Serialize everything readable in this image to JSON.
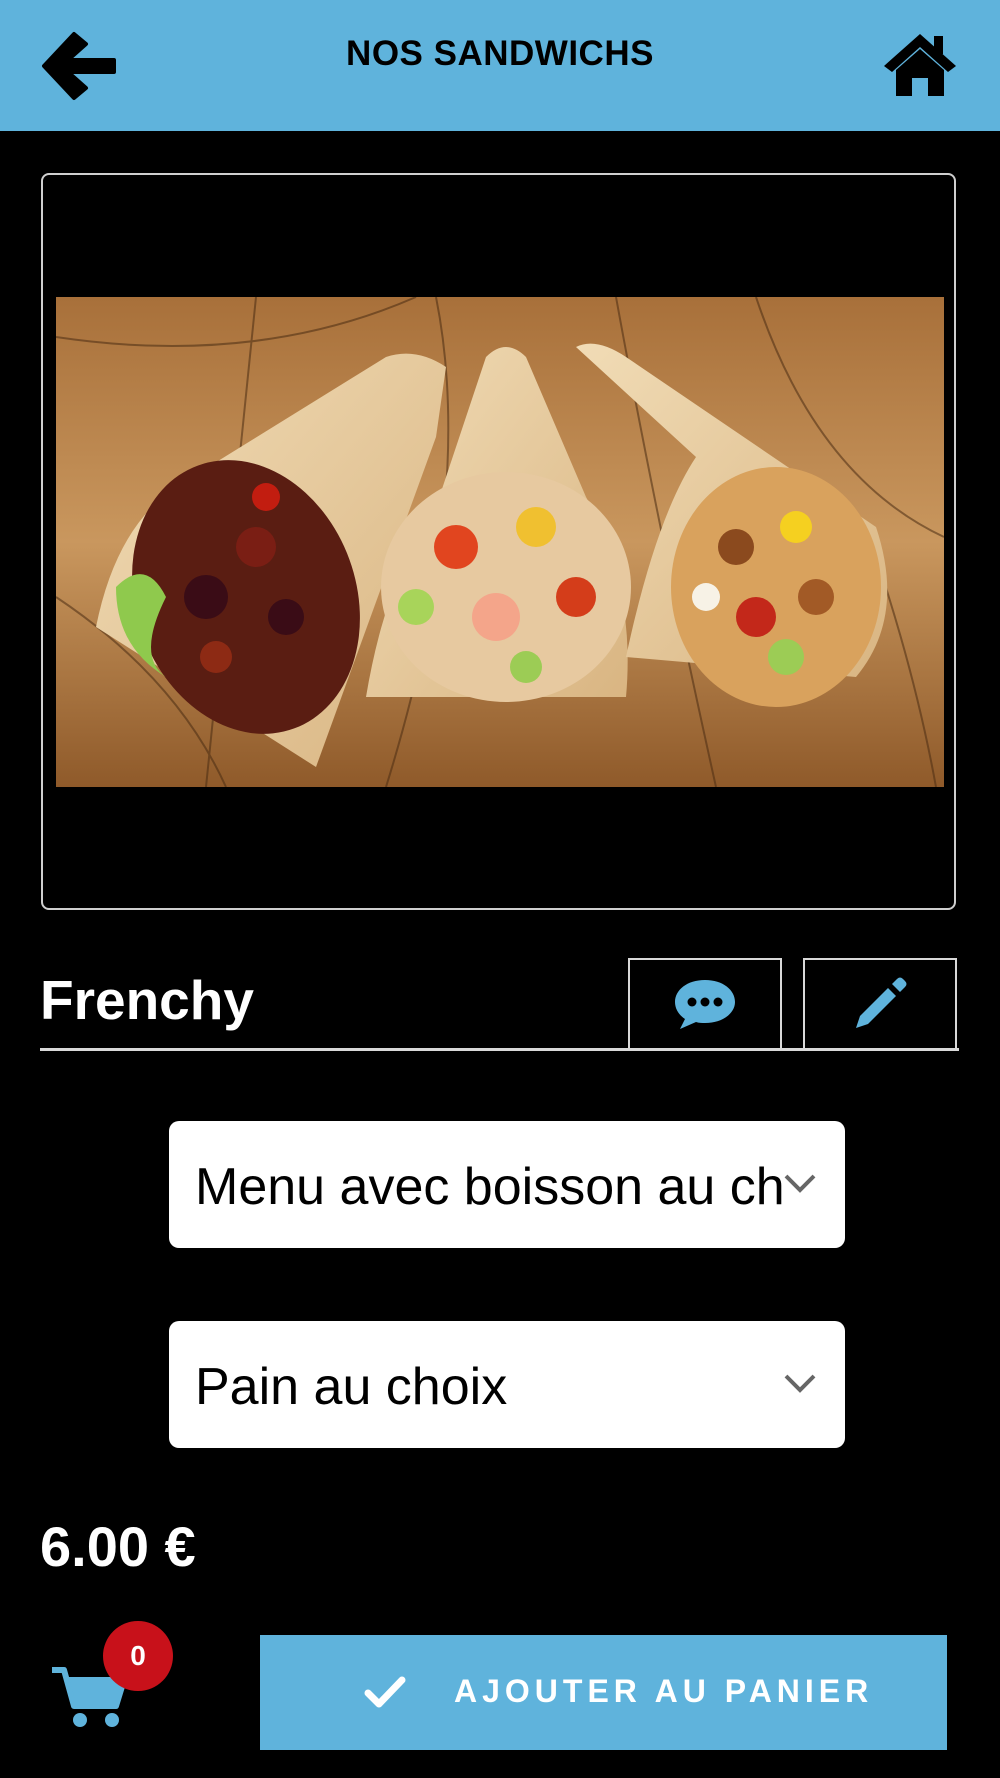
{
  "header": {
    "title": "NOS SANDWICHS",
    "background": "#5fb3dc",
    "back_icon": "arrow-left-icon",
    "home_icon": "home-icon"
  },
  "product": {
    "image": "wraps-photo",
    "name": "Frenchy",
    "comment_icon": "comment-icon",
    "edit_icon": "pencil-icon",
    "price": "6.00 €"
  },
  "options": {
    "menu_select": "Menu avec boisson au ch",
    "bread_select": "Pain au choix"
  },
  "cart": {
    "icon": "cart-icon",
    "count": "0",
    "badge_color": "#c8111a"
  },
  "actions": {
    "add_to_cart_label": "AJOUTER AU PANIER",
    "add_icon": "check-icon",
    "accent": "#5fb3dc"
  }
}
